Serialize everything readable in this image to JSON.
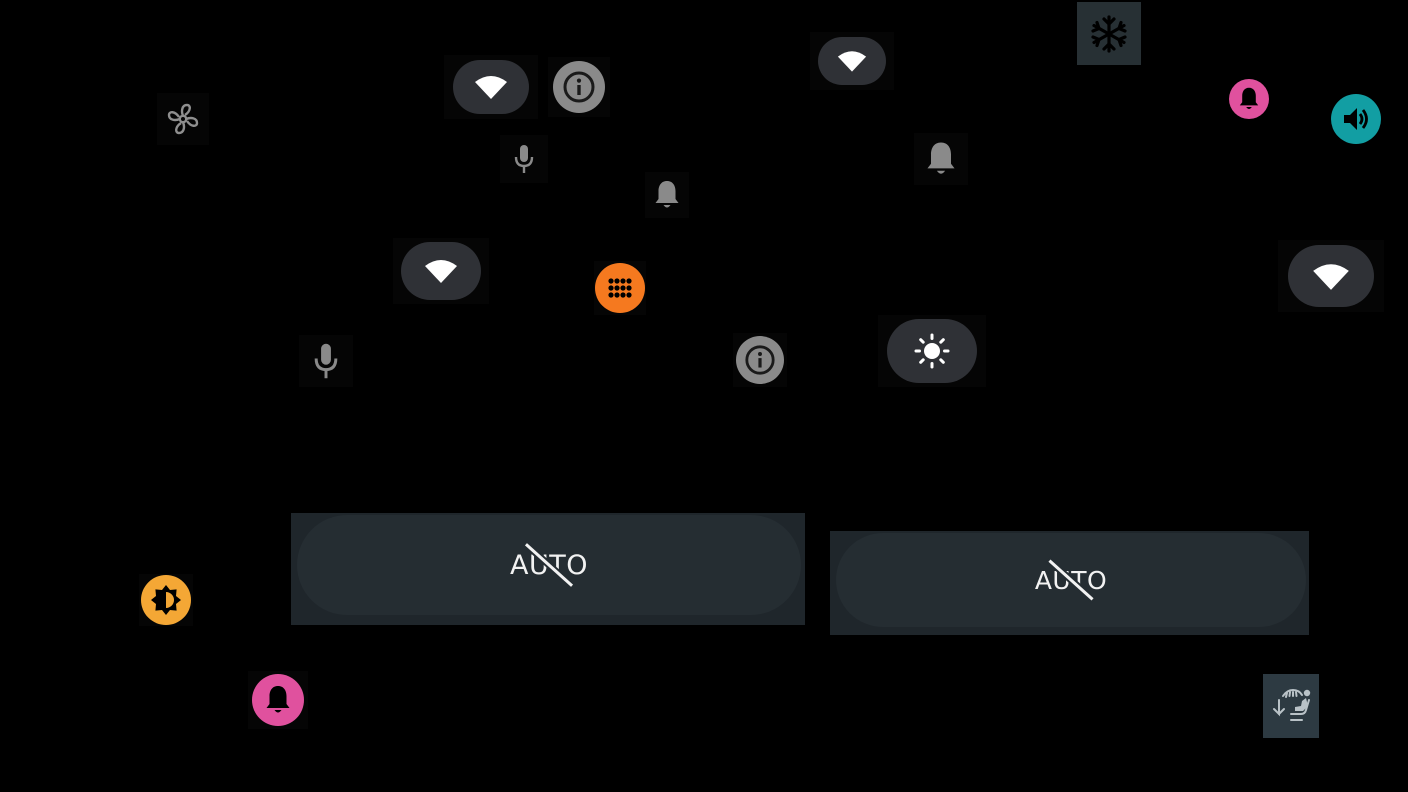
{
  "screen": {
    "background": "#000000",
    "icon_gray": "#8a8a8a",
    "pill_color": "#2f3136",
    "accent_pink": "#e0519e",
    "accent_teal": "#129ea3",
    "accent_orange": "#f5791f",
    "accent_amber": "#f4a735"
  },
  "controls": [
    {
      "id": "fan",
      "icon": "fan-icon"
    },
    {
      "id": "wifi-1",
      "icon": "wifi-icon"
    },
    {
      "id": "info-1",
      "icon": "info-icon"
    },
    {
      "id": "mic-1",
      "icon": "mic-icon"
    },
    {
      "id": "bell-1",
      "icon": "bell-icon"
    },
    {
      "id": "wifi-2",
      "icon": "wifi-icon"
    },
    {
      "id": "snowflake",
      "icon": "snowflake-icon"
    },
    {
      "id": "bell-2",
      "icon": "bell-icon"
    },
    {
      "id": "bell-pink-1",
      "icon": "bell-icon"
    },
    {
      "id": "volume",
      "icon": "volume-icon"
    },
    {
      "id": "wifi-3",
      "icon": "wifi-icon"
    },
    {
      "id": "apps",
      "icon": "apps-grid-icon"
    },
    {
      "id": "wifi-4",
      "icon": "wifi-icon"
    },
    {
      "id": "mic-2",
      "icon": "mic-icon"
    },
    {
      "id": "info-2",
      "icon": "info-icon"
    },
    {
      "id": "brightness",
      "icon": "brightness-icon"
    },
    {
      "id": "auto-brightness",
      "icon": "auto-brightness-icon"
    },
    {
      "id": "bell-pink-2",
      "icon": "bell-icon"
    },
    {
      "id": "seat-heat",
      "icon": "seat-heat-icon"
    }
  ],
  "auto_buttons": [
    {
      "label": "AUTO",
      "state": "off"
    },
    {
      "label": "AUTO",
      "state": "off"
    }
  ]
}
